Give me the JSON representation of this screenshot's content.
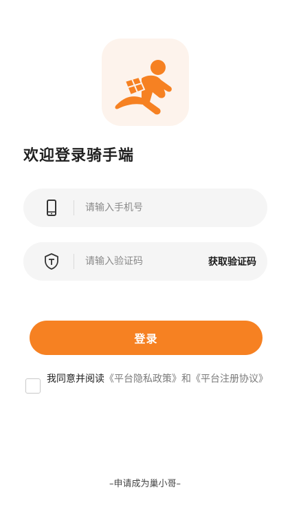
{
  "app": {
    "logo": "courier-runner-logo",
    "accent_color": "#F68122"
  },
  "welcome_title": "欢迎登录骑手端",
  "phone_field": {
    "icon": "phone-icon",
    "placeholder": "请输入手机号",
    "value": ""
  },
  "code_field": {
    "icon": "shield-icon",
    "placeholder": "请输入验证码",
    "value": "",
    "get_code_label": "获取验证码"
  },
  "login_button": {
    "label": "登录"
  },
  "agreement": {
    "checked": false,
    "prefix": "我同意并阅读",
    "privacy_link": "《平台隐私政策》",
    "joiner": "和",
    "register_link": "《平台注册协议》"
  },
  "apply_link": "–申请成为巢小哥–"
}
